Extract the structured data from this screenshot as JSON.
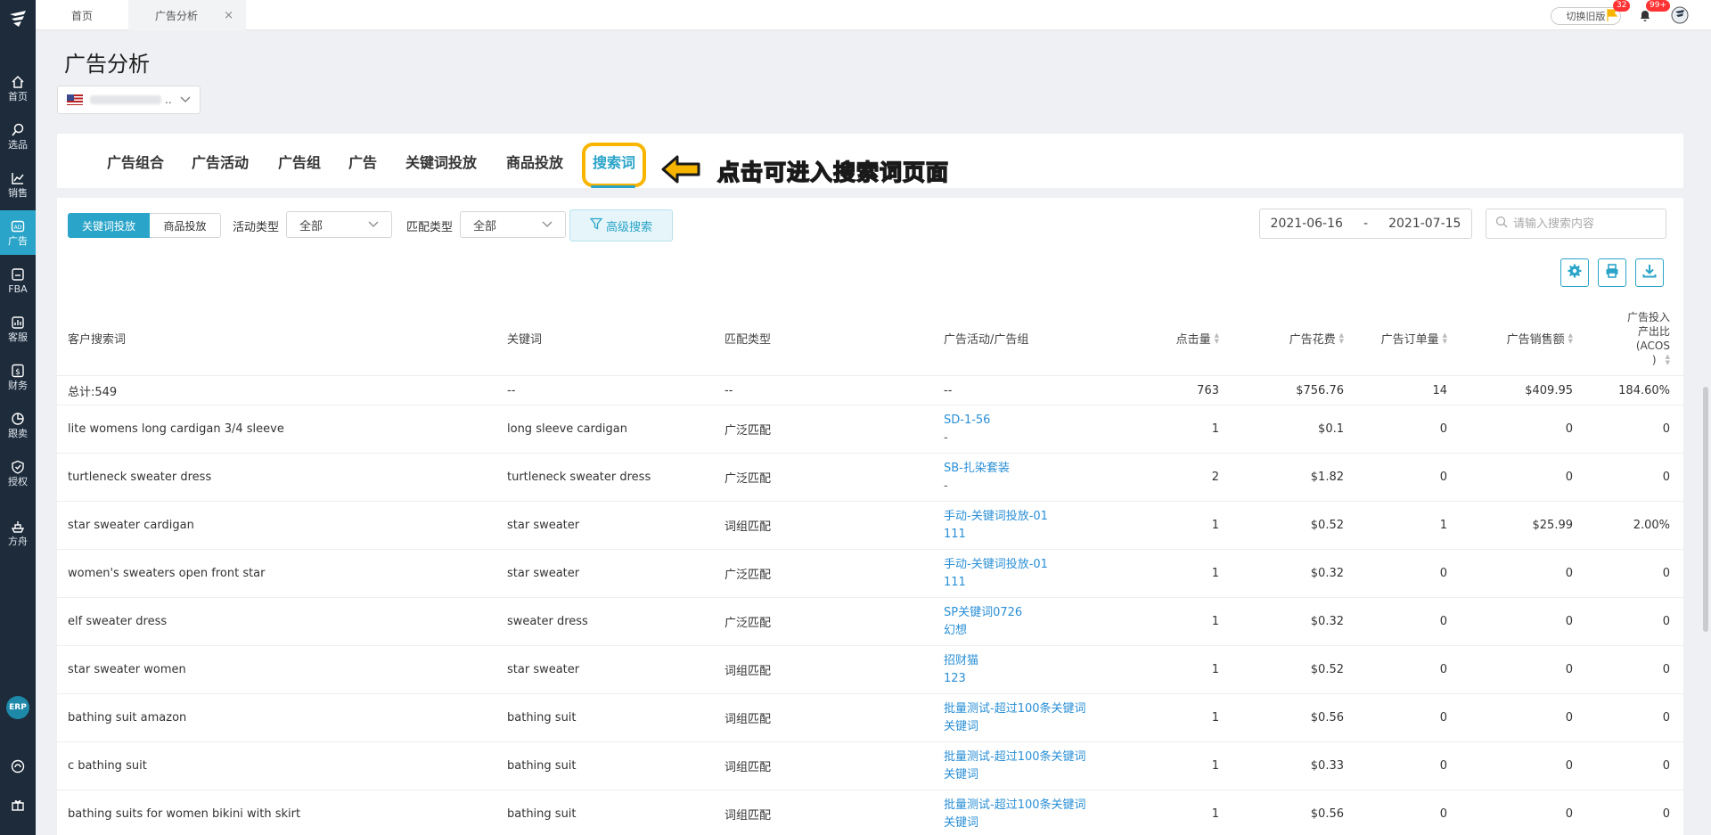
{
  "sidebar": {
    "items": [
      {
        "label": "首页",
        "icon": "home-icon"
      },
      {
        "label": "选品",
        "icon": "search-icon"
      },
      {
        "label": "销售",
        "icon": "chart-icon"
      },
      {
        "label": "广告",
        "icon": "ad-icon"
      },
      {
        "label": "FBA",
        "icon": "fba-icon"
      },
      {
        "label": "客服",
        "icon": "service-icon"
      },
      {
        "label": "财务",
        "icon": "finance-icon"
      },
      {
        "label": "跟卖",
        "icon": "pie-icon"
      },
      {
        "label": "授权",
        "icon": "shield-icon"
      },
      {
        "label": "方舟",
        "icon": "ark-icon"
      }
    ],
    "erp_label": "ERP"
  },
  "topbar": {
    "tabs": [
      {
        "label": "首页"
      },
      {
        "label": "广告分析"
      }
    ],
    "close_glyph": "×",
    "switch_label": "切换旧版",
    "flag_badge": "32",
    "bell_badge": "99+"
  },
  "page": {
    "title": "广告分析",
    "store_suffix": ".."
  },
  "nav": {
    "tabs": [
      "广告组合",
      "广告活动",
      "广告组",
      "广告",
      "关键词投放",
      "商品投放",
      "搜索词"
    ],
    "active": "搜索词",
    "callout": "点击可进入搜索词页面"
  },
  "filters": {
    "seg": [
      "关键词投放",
      "商品投放"
    ],
    "activity_label": "活动类型",
    "activity_value": "全部",
    "match_label": "匹配类型",
    "match_value": "全部",
    "advanced_label": "高级搜索",
    "date_start": "2021-06-16",
    "date_sep": "-",
    "date_end": "2021-07-15",
    "search_placeholder": "请输入搜索内容"
  },
  "table": {
    "headers": {
      "term": "客户搜索词",
      "keyword": "关键词",
      "match": "匹配类型",
      "campaign": "广告活动/广告组",
      "clicks": "点击量",
      "spend": "广告花费",
      "orders": "广告订单量",
      "sales": "广告销售额",
      "acos_l1": "广告投入",
      "acos_l2": "产出比",
      "acos_l3": "(ACOS",
      "acos_l4": ")"
    },
    "total": {
      "term": "总计:549",
      "keyword": "--",
      "match": "--",
      "campaign": "--",
      "clicks": "763",
      "spend": "$756.76",
      "orders": "14",
      "sales": "$409.95",
      "acos": "184.60%"
    },
    "rows": [
      {
        "term": "lite womens long cardigan 3/4 sleeve",
        "keyword": "long sleeve cardigan",
        "match": "广泛匹配",
        "campaign": "SD-1-56",
        "group": "-",
        "clicks": "1",
        "spend": "$0.1",
        "orders": "0",
        "sales": "0",
        "acos": "0"
      },
      {
        "term": "turtleneck sweater dress",
        "keyword": "turtleneck sweater dress",
        "match": "广泛匹配",
        "campaign": "SB-扎染套装",
        "group": "-",
        "clicks": "2",
        "spend": "$1.82",
        "orders": "0",
        "sales": "0",
        "acos": "0"
      },
      {
        "term": "star sweater cardigan",
        "keyword": "star sweater",
        "match": "词组匹配",
        "campaign": "手动-关键词投放-01",
        "group": "111",
        "clicks": "1",
        "spend": "$0.52",
        "orders": "1",
        "sales": "$25.99",
        "acos": "2.00%"
      },
      {
        "term": "women's sweaters open front star",
        "keyword": "star sweater",
        "match": "广泛匹配",
        "campaign": "手动-关键词投放-01",
        "group": "111",
        "clicks": "1",
        "spend": "$0.32",
        "orders": "0",
        "sales": "0",
        "acos": "0"
      },
      {
        "term": "elf sweater dress",
        "keyword": "sweater dress",
        "match": "广泛匹配",
        "campaign": "SP关键词0726",
        "group": "幻想",
        "clicks": "1",
        "spend": "$0.32",
        "orders": "0",
        "sales": "0",
        "acos": "0"
      },
      {
        "term": "star sweater women",
        "keyword": "star sweater",
        "match": "词组匹配",
        "campaign": "招财猫",
        "group": "123",
        "clicks": "1",
        "spend": "$0.52",
        "orders": "0",
        "sales": "0",
        "acos": "0"
      },
      {
        "term": "bathing suit amazon",
        "keyword": "bathing suit",
        "match": "词组匹配",
        "campaign": "批量测试-超过100条关键词",
        "group": "关键词",
        "clicks": "1",
        "spend": "$0.56",
        "orders": "0",
        "sales": "0",
        "acos": "0"
      },
      {
        "term": "c bathing suit",
        "keyword": "bathing suit",
        "match": "词组匹配",
        "campaign": "批量测试-超过100条关键词",
        "group": "关键词",
        "clicks": "1",
        "spend": "$0.33",
        "orders": "0",
        "sales": "0",
        "acos": "0"
      },
      {
        "term": "bathing suits for women bikini with skirt",
        "keyword": "bathing suit",
        "match": "词组匹配",
        "campaign": "批量测试-超过100条关键词",
        "group": "关键词",
        "clicks": "1",
        "spend": "$0.56",
        "orders": "0",
        "sales": "0",
        "acos": "0"
      }
    ]
  },
  "colors": {
    "accent": "#2aa5c9",
    "sidebar_bg": "#1d2b3a",
    "highlight": "#f7b500",
    "link": "#2a8fd6"
  }
}
